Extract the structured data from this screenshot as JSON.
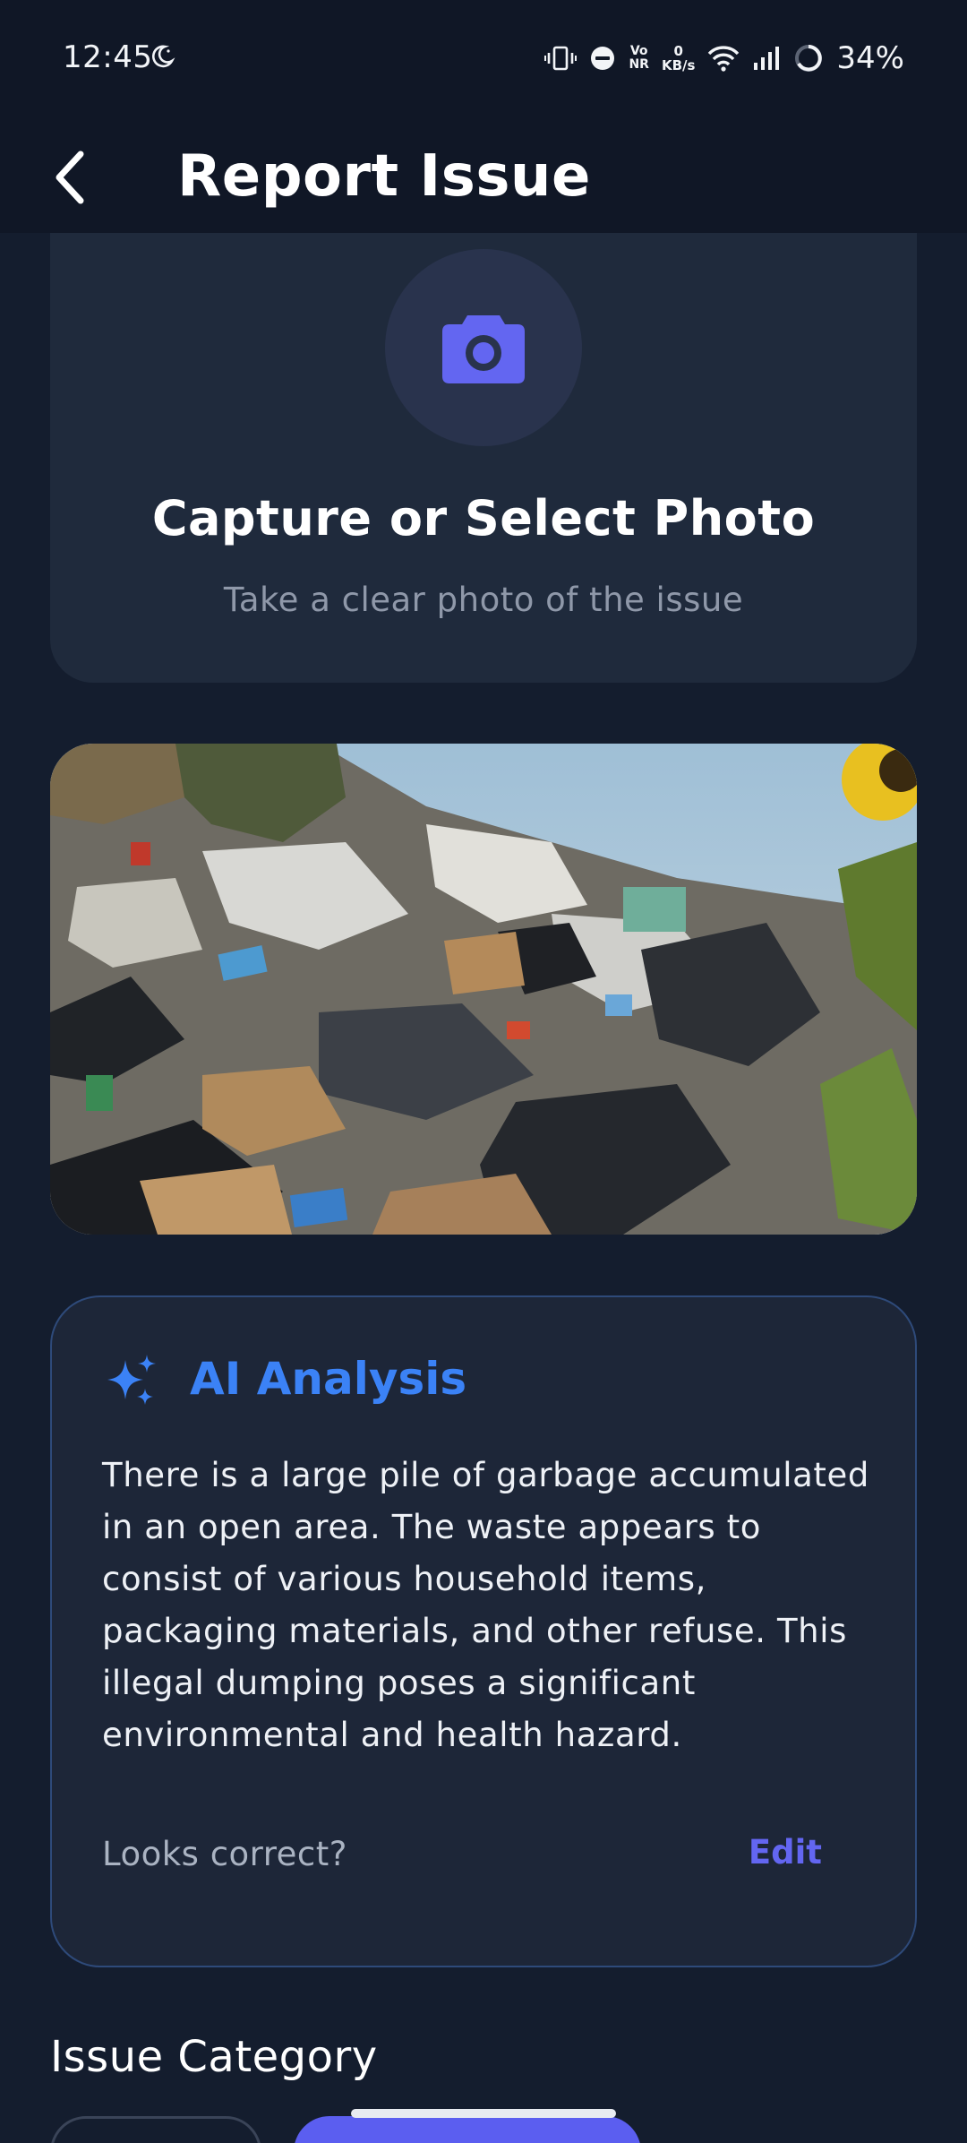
{
  "status_bar": {
    "time": "12:45",
    "net_speed_value": "0",
    "net_speed_unit": "KB/s",
    "volte_top": "Vo",
    "volte_bottom": "NR",
    "battery": "34%"
  },
  "header": {
    "title": "Report Issue"
  },
  "capture": {
    "title": "Capture or Select Photo",
    "subtitle": "Take a clear photo of the issue"
  },
  "ai_analysis": {
    "title": "AI Analysis",
    "text": "There is a large pile of garbage accumulated in an open area.  The waste appears to consist of various household items, packaging materials, and other refuse.  This illegal dumping poses a significant environmental and health hazard.",
    "question": "Looks correct?",
    "edit_label": "Edit"
  },
  "issue_category": {
    "label": "Issue Category"
  },
  "colors": {
    "accent": "#6366f1",
    "ai_blue": "#3b82f6",
    "background": "#141d2e",
    "card": "#1f2a3c"
  },
  "icons": {
    "back": "chevron-left-icon",
    "camera": "camera-icon",
    "ai": "sparkle-icon"
  }
}
